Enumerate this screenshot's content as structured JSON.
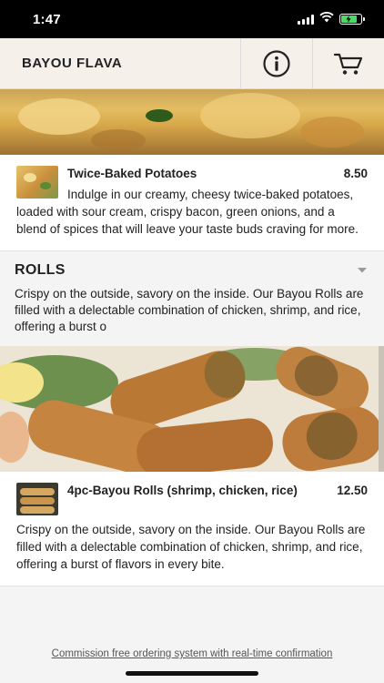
{
  "status_bar": {
    "time": "1:47",
    "battery_charging": true,
    "battery_level": 0.8
  },
  "header": {
    "brand": "BAYOU FLAVA",
    "info_icon": "info-icon",
    "cart_icon": "cart-icon"
  },
  "items_top": [
    {
      "name": "Twice-Baked Potatoes",
      "price": "8.50",
      "description": "Indulge in our creamy, cheesy twice-baked potatoes, loaded with sour cream, crispy bacon, green onions, and a blend of spices that will leave your taste buds craving for more."
    }
  ],
  "section": {
    "title": "ROLLS",
    "toggle_icon": "chevron-down-icon",
    "description": "Crispy on the outside, savory on the inside. Our Bayou Rolls are filled with a delectable combination of chicken, shrimp, and rice, offering a burst o"
  },
  "items_rolls": [
    {
      "name": "4pc-Bayou Rolls (shrimp, chicken, rice)",
      "price": "12.50",
      "description": "Crispy on the outside, savory on the inside. Our Bayou Rolls are filled with a delectable combination of chicken, shrimp, and rice, offering a burst of flavors in every bite."
    }
  ],
  "footer": {
    "link_text": "Commission free ordering system with real-time confirmation"
  },
  "colors": {
    "header_bg": "#f5f1ea",
    "status_bg": "#000000",
    "battery_green": "#4cd964"
  }
}
